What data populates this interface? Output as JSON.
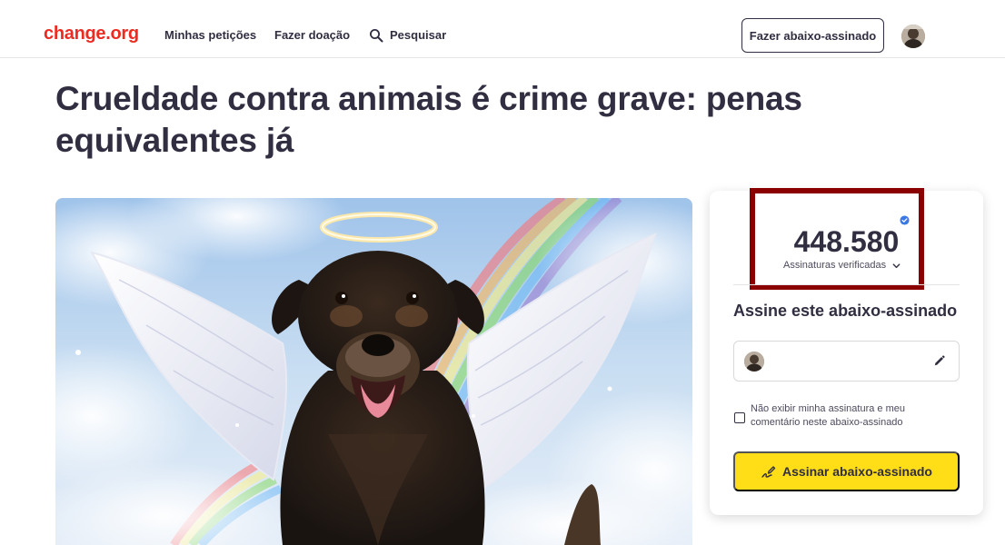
{
  "header": {
    "logo": "change.org",
    "nav": {
      "my_petitions": "Minhas petições",
      "donate": "Fazer doação",
      "search": "Pesquisar"
    },
    "start_button": "Fazer abaixo-assinado"
  },
  "petition": {
    "title": "Crueldade contra animais é crime grave: penas equivalentes já"
  },
  "sign_card": {
    "signature_count": "448.580",
    "count_label": "Assinaturas verificadas",
    "heading": "Assine este abaixo-assinado",
    "hide_signature_label": "Não exibir minha assinatura e meu comentário neste abaixo-assinado",
    "hide_signature_checked": false,
    "sign_button": "Assinar abaixo-assinado"
  },
  "colors": {
    "brand": "#ec2c22",
    "sign_button": "#ffdd17",
    "highlight": "#8b0000",
    "verified": "#3a78e5",
    "text": "#312e41"
  },
  "icons": {
    "search": "search-icon",
    "verified": "verified-badge-icon",
    "expand": "chevron-down-icon",
    "edit": "pencil-icon",
    "sign": "signature-pen-icon"
  }
}
